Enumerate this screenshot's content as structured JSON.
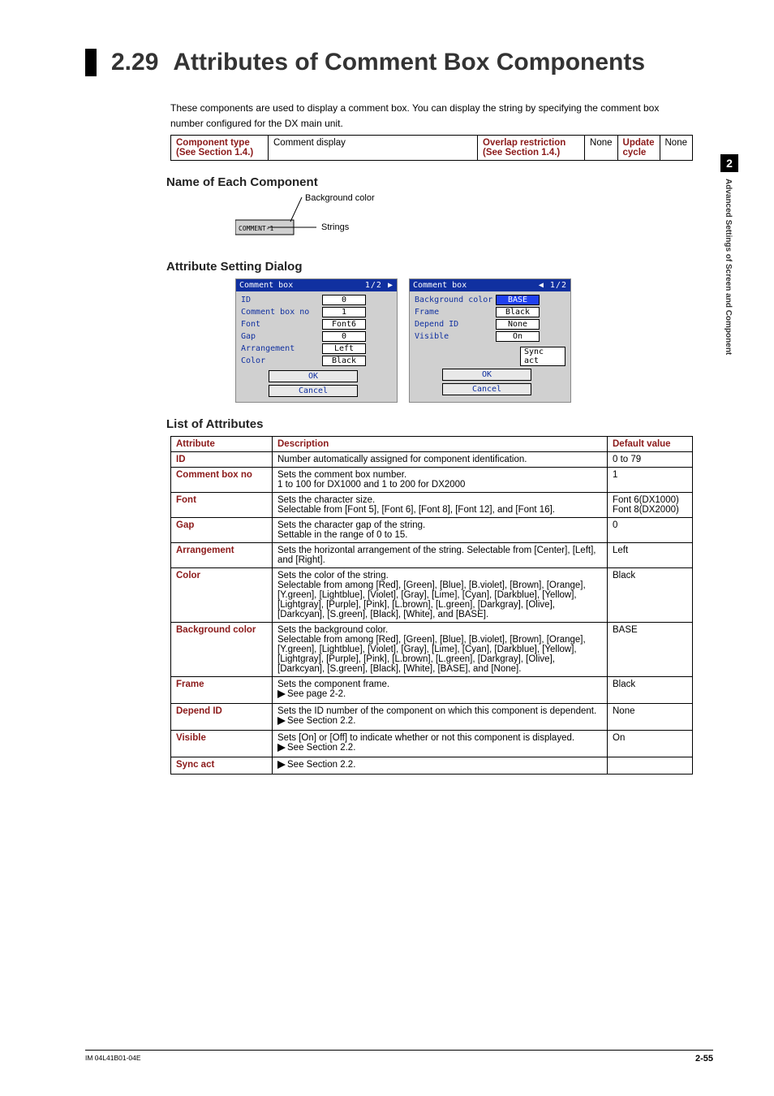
{
  "heading": {
    "num": "2.29",
    "title": "Attributes of Comment Box Components"
  },
  "side": {
    "chapter": "2",
    "text": "Advanced Settings of Screen and Component"
  },
  "intro": "These components are used to display a comment box.  You can display the string by specifying the comment box number configured for the DX main unit.",
  "info": {
    "comp_type_lbl": "Component type",
    "comp_type_see": "(See Section 1.4.)",
    "comp_type_val": "Comment display",
    "overlap_lbl": "Overlap restriction",
    "overlap_see": "(See Section 1.4.)",
    "overlap_val": "None",
    "update_lbl": "Update cycle",
    "update_val": "None"
  },
  "sec_name": "Name of Each Component",
  "diagram": {
    "bg_label": "Background color",
    "strings_label": "Strings",
    "box_text": "COMMENT-1"
  },
  "sec_attr_dialog": "Attribute Setting Dialog",
  "dlg1": {
    "title": "Comment box",
    "arrows_r": "1/2 ▶",
    "rows": [
      {
        "l": "ID",
        "v": "0"
      },
      {
        "l": "Comment box no",
        "v": "1"
      },
      {
        "l": "Font",
        "v": "Font6"
      },
      {
        "l": "Gap",
        "v": "0"
      },
      {
        "l": "Arrangement",
        "v": "Left"
      },
      {
        "l": "Color",
        "v": "Black"
      }
    ],
    "ok": "OK",
    "cancel": "Cancel"
  },
  "dlg2": {
    "title": "Comment box",
    "arrows_l": "◀ 1/2",
    "rows": [
      {
        "l": "Background color",
        "v": "BASE",
        "cls": "base"
      },
      {
        "l": "Frame",
        "v": "Black"
      },
      {
        "l": "Depend ID",
        "v": "None"
      },
      {
        "l": "Visible",
        "v": "On"
      }
    ],
    "sync": "Sync act",
    "ok": "OK",
    "cancel": "Cancel"
  },
  "sec_list": "List of Attributes",
  "attr_header": {
    "a": "Attribute",
    "d": "Description",
    "v": "Default value"
  },
  "attrs": [
    {
      "name": "ID",
      "desc": [
        "Number automatically assigned for component identification."
      ],
      "def": "0 to 79"
    },
    {
      "name": "Comment box no",
      "desc": [
        "Sets the comment box number.",
        "1 to 100 for DX1000 and 1 to 200 for DX2000"
      ],
      "def": "1"
    },
    {
      "name": "Font",
      "desc": [
        "Sets the character size.",
        "Selectable from [Font 5], [Font 6], [Font 8], [Font 12], and [Font 16]."
      ],
      "def": "Font 6(DX1000)\nFont 8(DX2000)"
    },
    {
      "name": "Gap",
      "desc": [
        "Sets the character gap of the string.",
        "Settable in the range of 0 to 15."
      ],
      "def": "0"
    },
    {
      "name": "Arrangement",
      "desc": [
        "Sets the horizontal arrangement of the string. Selectable from [Center], [Left], and [Right]."
      ],
      "def": "Left"
    },
    {
      "name": "Color",
      "desc": [
        "Sets the color of the string.",
        "Selectable from among [Red], [Green], [Blue], [B.violet], [Brown], [Orange], [Y.green], [Lightblue], [Violet], [Gray], [Lime], [Cyan], [Darkblue], [Yellow], [Lightgray], [Purple], [Pink], [L.brown], [L.green], [Darkgray], [Olive], [Darkcyan], [S.green], [Black], [White], and [BASE]."
      ],
      "def": "Black"
    },
    {
      "name": "Background color",
      "desc": [
        "Sets the background color.",
        "Selectable from among [Red], [Green], [Blue], [B.violet], [Brown], [Orange], [Y.green], [Lightblue], [Violet], [Gray], [Lime], [Cyan], [Darkblue], [Yellow], [Lightgray], [Purple], [Pink], [L.brown], [L.green], [Darkgray], [Olive], [Darkcyan], [S.green], [Black], [White], [BASE], and [None]."
      ],
      "def": "BASE"
    },
    {
      "name": "Frame",
      "desc": [
        "Sets the component frame."
      ],
      "see": "See page 2-2.",
      "def": "Black"
    },
    {
      "name": "Depend ID",
      "desc": [
        "Sets the ID number of the component on which this component is dependent."
      ],
      "see": "See Section 2.2.",
      "def": "None"
    },
    {
      "name": "Visible",
      "desc": [
        "Sets [On] or [Off] to indicate whether or not this component is displayed."
      ],
      "see": "See Section 2.2.",
      "def": "On"
    },
    {
      "name": "Sync act",
      "see": "See Section 2.2.",
      "desc": [],
      "def": ""
    }
  ],
  "footer": {
    "code": "IM 04L41B01-04E",
    "page": "2-55"
  }
}
